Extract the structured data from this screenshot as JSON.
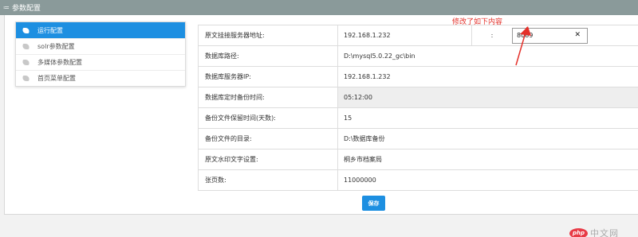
{
  "header": {
    "icon": "list-icon",
    "icon_glyph": "≔",
    "title": "参数配置"
  },
  "sidebar": {
    "items": [
      {
        "label": "运行配置",
        "icon": "leaf-icon",
        "active": true
      },
      {
        "label": "solr参数配置",
        "icon": "leaf-icon",
        "active": false
      },
      {
        "label": "多媒体参数配置",
        "icon": "leaf-icon",
        "active": false
      },
      {
        "label": "首页菜单配置",
        "icon": "leaf-icon",
        "active": false
      }
    ]
  },
  "form": {
    "server": {
      "label": "原文挂接服务器地址:",
      "host": "192.168.1.232",
      "separator": ":",
      "port": "8089",
      "clear_glyph": "✕"
    },
    "db_path": {
      "label": "数据库路径:",
      "value": "D:\\mysql5.0.22_gc\\bin"
    },
    "db_ip": {
      "label": "数据库服务器IP:",
      "value": "192.168.1.232"
    },
    "backup_time": {
      "label": "数据库定时备份时间:",
      "value": "05:12:00"
    },
    "retention": {
      "label": "备份文件保留时间(天数):",
      "value": "15"
    },
    "backup_dir": {
      "label": "备份文件的目录:",
      "value": "D:\\数据库备份"
    },
    "watermark": {
      "label": "原文水印文字设置:",
      "value": "桐乡市档案局"
    },
    "pages": {
      "label": "张页数:",
      "value": "11000000"
    }
  },
  "save_label": "保存",
  "annotation": {
    "text": "修改了如下内容",
    "color": "#e4302a"
  },
  "site_watermark": {
    "logo": "php",
    "text": "中文网"
  },
  "colors": {
    "accent": "#1d8fe1",
    "titlebar": "#8a9a9a"
  }
}
